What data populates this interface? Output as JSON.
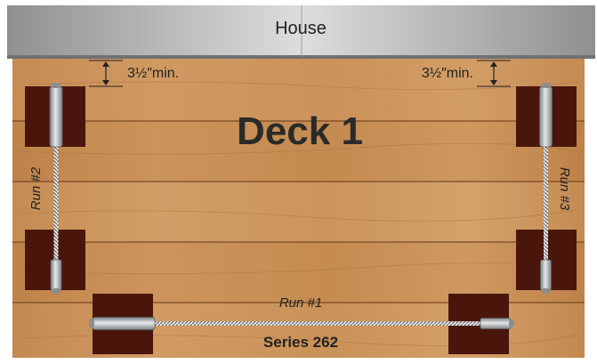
{
  "house": {
    "label": "House"
  },
  "deck": {
    "title": "Deck 1"
  },
  "clearance": {
    "left_label": "3½″min.",
    "right_label": "3½″min."
  },
  "runs": {
    "run1": "Run #1",
    "run2": "Run #2",
    "run3": "Run #3"
  },
  "series": {
    "label": "Series 262"
  },
  "colors": {
    "wood_light": "#cf9a62",
    "wood_dark": "#b57a43",
    "post": "#4a160c",
    "house_mid": "#d9dadb",
    "house_edge": "#8c8e90",
    "hardware": "#b9bcbf",
    "text": "#2a2a2a"
  }
}
